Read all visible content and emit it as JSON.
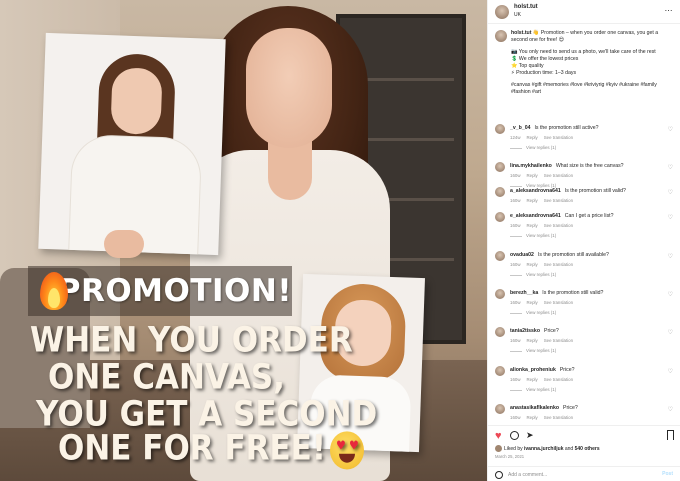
{
  "image": {
    "promo_title": "PROMOTION!",
    "promo_lines": [
      "WHEN YOU ORDER",
      "ONE CANVAS,",
      "YOU GET A SECOND",
      "ONE FOR FREE!"
    ]
  },
  "header": {
    "username": "holst.tut",
    "location": "UK",
    "more_icon": "⋯"
  },
  "caption": {
    "username": "holst.tut",
    "line1": "👋 Promotion – when you order one canvas, you get a second one for free! 😍",
    "line2": "📷 You only need to send us a photo, we'll take care of the rest",
    "line3": "💲 We offer the lowest prices",
    "line4": "⭐ Top quality",
    "line5": "⚡ Production time: 1–3 days",
    "hashtags": "#canvas #gift #memories #love #kriviyrig #kyiv #ukraine #family #fashion #art"
  },
  "comments": [
    {
      "user": "_v_b_04",
      "text": "Is the promotion still active?",
      "time": "124w",
      "reply": "Reply",
      "translate": "See translation",
      "replies": "View replies (1)"
    },
    {
      "user": "lina.mykhailenko",
      "text": "What size is the free canvas?",
      "time": "160w",
      "reply": "Reply",
      "translate": "See translation",
      "replies": "View replies (1)"
    },
    {
      "user": "a_aleksandrovna641",
      "text": "Is the promotion still valid?",
      "time": "160w",
      "reply": "Reply",
      "translate": "See translation",
      "replies": ""
    },
    {
      "user": "e_aleksandrovna641",
      "text": "Can I get a price list?",
      "time": "160w",
      "reply": "Reply",
      "translate": "See translation",
      "replies": "View replies (1)"
    },
    {
      "user": "ovadua02",
      "text": "Is the promotion still available?",
      "time": "160w",
      "reply": "Reply",
      "translate": "See translation",
      "replies": "View replies (1)"
    },
    {
      "user": "berezh__ka",
      "text": "Is the promotion still valid?",
      "time": "160w",
      "reply": "Reply",
      "translate": "See translation",
      "replies": "View replies (1)"
    },
    {
      "user": "tania2tissko",
      "text": "Price?",
      "time": "160w",
      "reply": "Reply",
      "translate": "See translation",
      "replies": "View replies (1)"
    },
    {
      "user": "alionka_proheniuk",
      "text": "Price?",
      "time": "160w",
      "reply": "Reply",
      "translate": "See translation",
      "replies": "View replies (1)"
    },
    {
      "user": "anastasikaflkalenko",
      "text": "Price?",
      "time": "160w",
      "reply": "Reply",
      "translate": "See translation",
      "replies": ""
    }
  ],
  "actions": {
    "liked_by_prefix": "Liked by ",
    "liked_by_user": "ivanna.jurchiljuk",
    "liked_by_and": " and ",
    "liked_by_others": "540 others",
    "date": "March 25, 2021",
    "comment_placeholder": "Add a comment...",
    "post_label": "Post"
  },
  "colors": {
    "like": "#ed4956",
    "link_disabled": "#b2dffc",
    "muted": "#8e8e8e"
  }
}
